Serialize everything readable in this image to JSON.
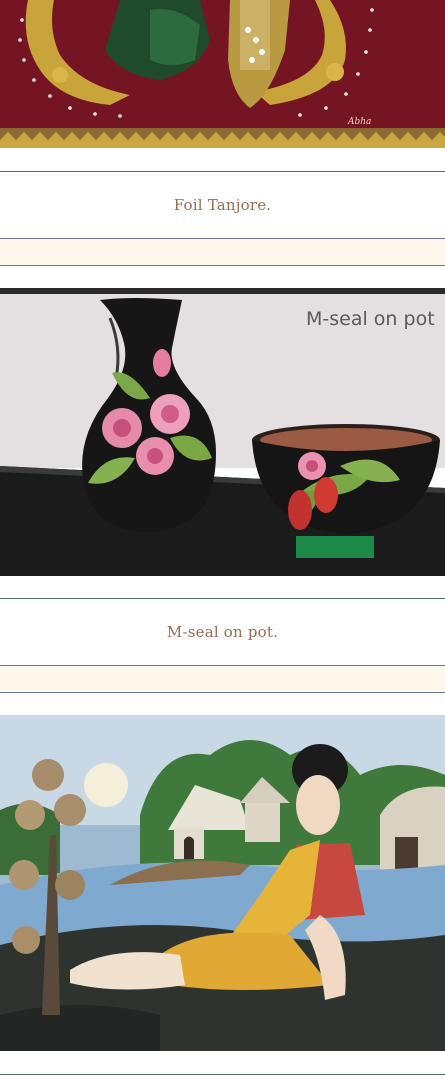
{
  "gallery": {
    "items": [
      {
        "image": {
          "signature": "Abha"
        },
        "caption": "Foil Tanjore."
      },
      {
        "image": {
          "overlay_text": "M-seal on pot"
        },
        "caption": "M-seal on pot."
      },
      {
        "image": {}
      }
    ]
  },
  "colors": {
    "caption_text": "#9a6a52",
    "card_border": "#4d6b62",
    "stripe_fill": "#fdf7ec",
    "stripe_border": "#6a73a8"
  }
}
